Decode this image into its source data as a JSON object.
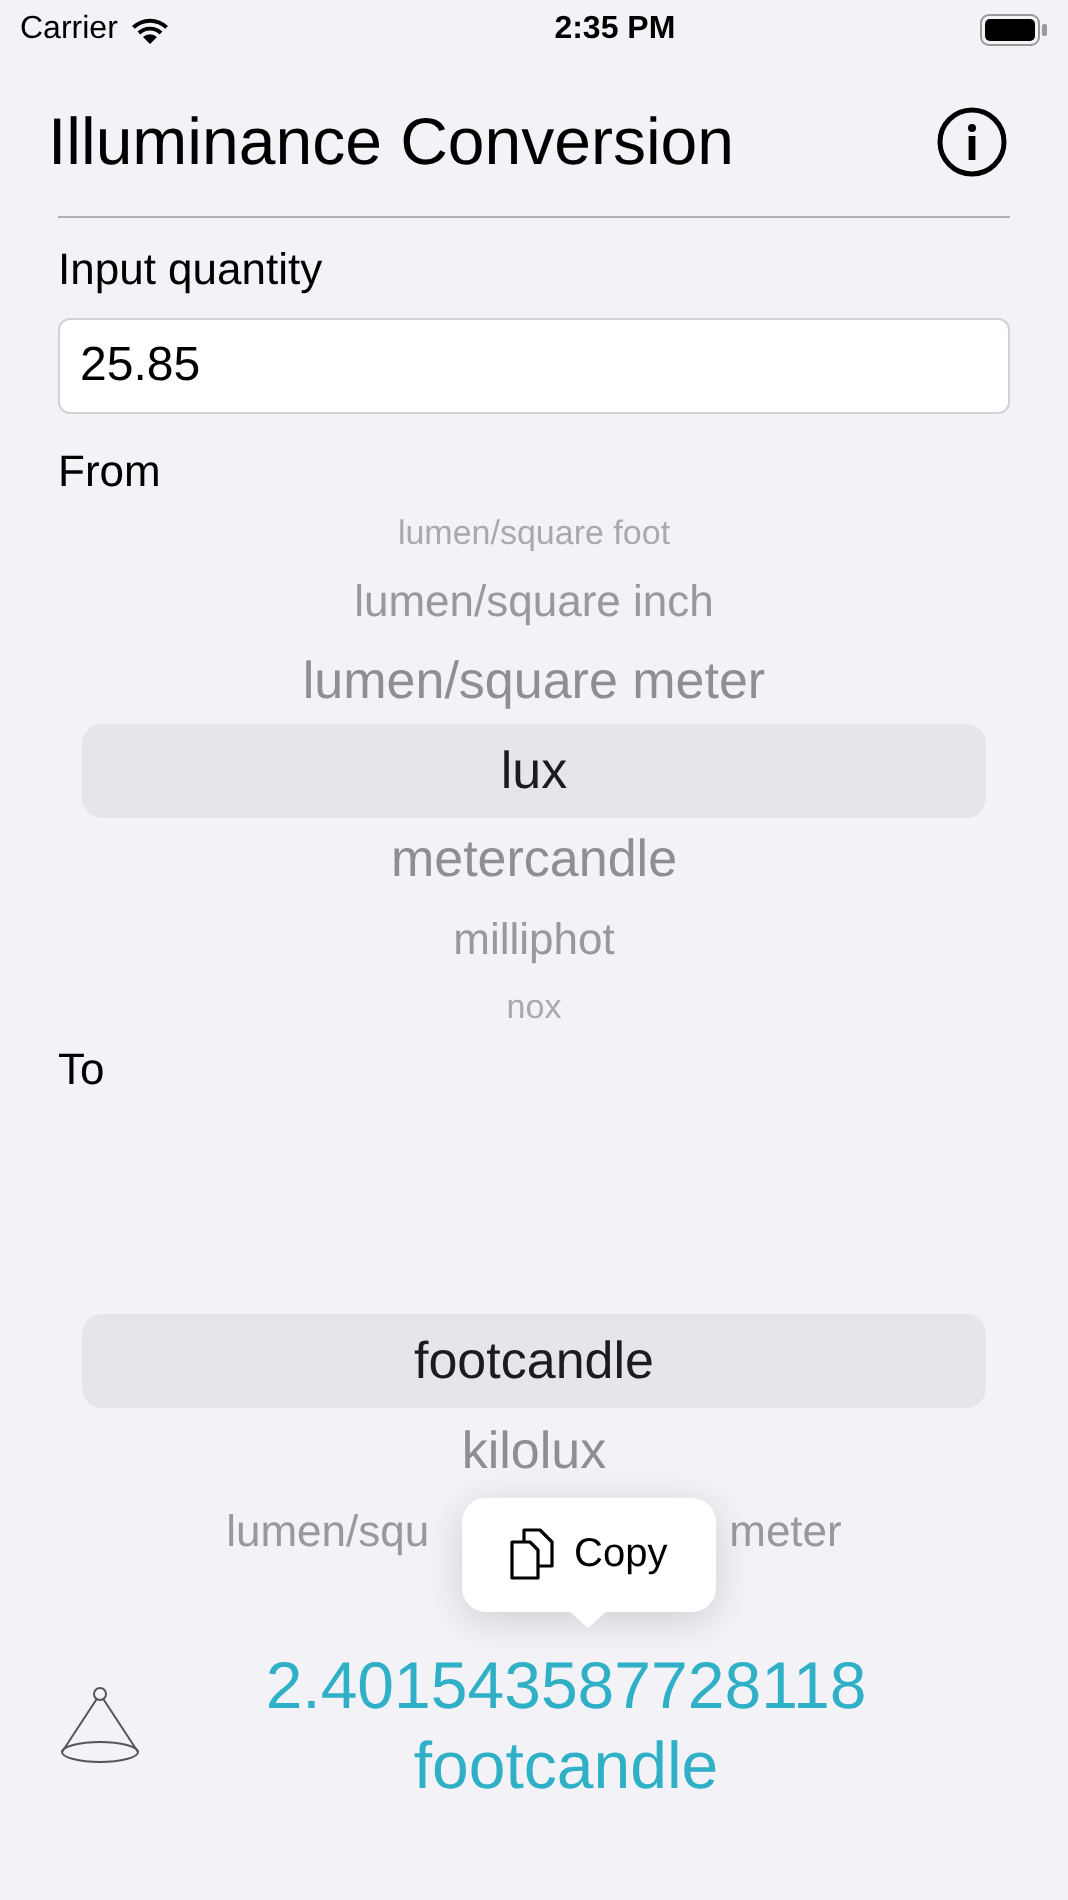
{
  "status_bar": {
    "carrier": "Carrier",
    "time": "2:35 PM"
  },
  "header": {
    "title": "Illuminance Conversion"
  },
  "input": {
    "label": "Input quantity",
    "value": "25.85"
  },
  "from_picker": {
    "label": "From",
    "items": [
      {
        "label": "lumen/square foot",
        "selected": false
      },
      {
        "label": "lumen/square inch",
        "selected": false
      },
      {
        "label": "lumen/square meter",
        "selected": false
      },
      {
        "label": "lux",
        "selected": true
      },
      {
        "label": "metercandle",
        "selected": false
      },
      {
        "label": "milliphot",
        "selected": false
      },
      {
        "label": "nox",
        "selected": false
      }
    ]
  },
  "to_picker": {
    "label": "To",
    "items": [
      {
        "label": "footcandle",
        "selected": true
      },
      {
        "label": "kilolux",
        "selected": false
      },
      {
        "fragments": [
          "lumen/squ",
          "meter"
        ],
        "selected": false
      }
    ]
  },
  "copy_menu": {
    "label": "Copy"
  },
  "result": {
    "value": "2.401543587728118",
    "unit": "footcandle"
  }
}
